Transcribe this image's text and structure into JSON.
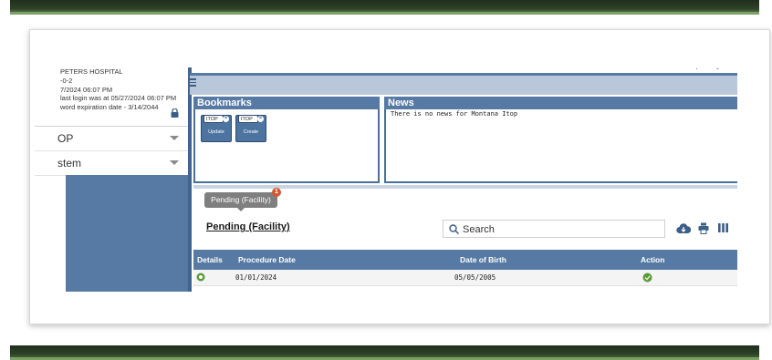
{
  "sidebar": {
    "info_lines": [
      "PETERS HOSPITAL",
      "-0-2",
      "7/2024 06:07 PM",
      "last login was at 05/27/2024 06:07 PM",
      "word expiration date - 3/14/2044"
    ],
    "menu": [
      {
        "label": "OP"
      },
      {
        "label": "stem"
      }
    ]
  },
  "bookmarks": {
    "title": "Bookmarks",
    "cards": [
      {
        "tag": "ITOP",
        "label": "Update"
      },
      {
        "tag": "ITOP",
        "label": "Create"
      }
    ]
  },
  "news": {
    "title": "News",
    "message": "There is no news for Montana Itop"
  },
  "pending": {
    "tab_label": "Pending (Facility)",
    "badge_count": "1",
    "title": "Pending (Facility)",
    "search_placeholder": "Search"
  },
  "table": {
    "columns": [
      "Details",
      "Procedure Date",
      "Date of Birth",
      "Action"
    ],
    "rows": [
      {
        "procedure_date": "01/01/2024",
        "date_of_birth": "05/05/2005"
      }
    ]
  },
  "colors": {
    "accent": "#567aa3",
    "header_band": "#2e4228",
    "badge": "#d4582e",
    "action_green": "#5a9a3c"
  }
}
